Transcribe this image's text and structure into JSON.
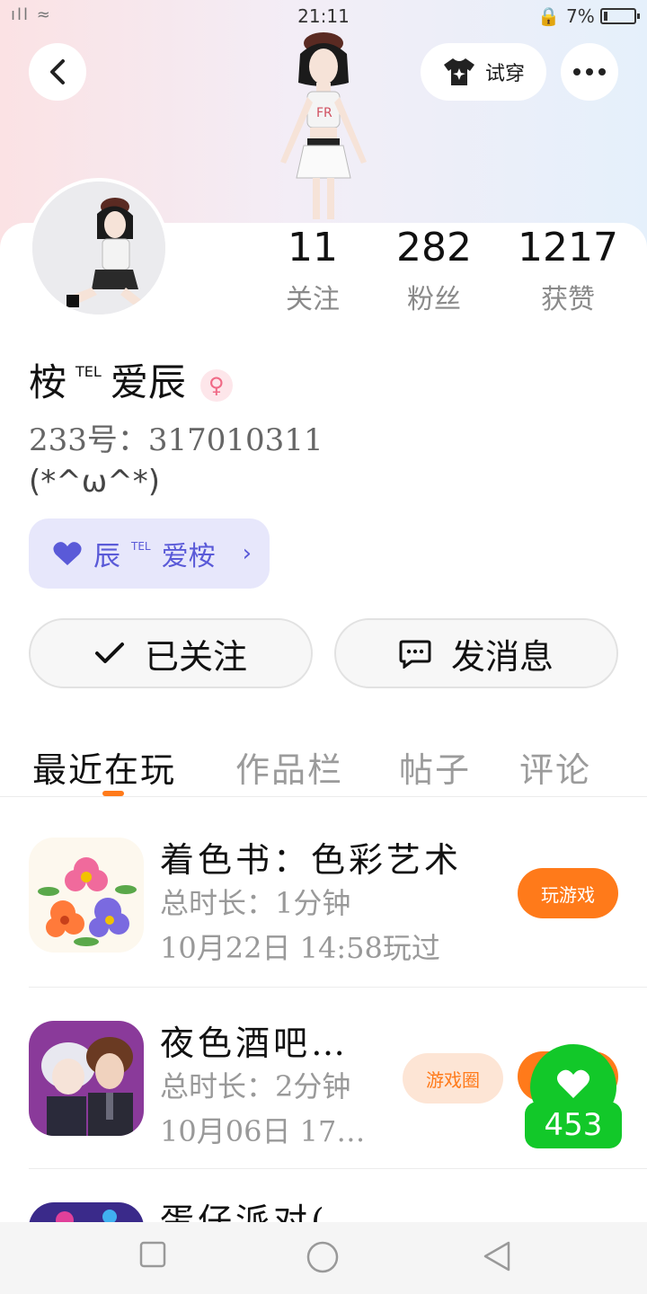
{
  "status_bar": {
    "time": "21:11",
    "battery": "7%"
  },
  "header": {
    "try_on_label": "试穿"
  },
  "stats": [
    {
      "value": "11",
      "label": "关注"
    },
    {
      "value": "282",
      "label": "粉丝"
    },
    {
      "value": "1217",
      "label": "获赞"
    }
  ],
  "profile": {
    "name_part1": "桉",
    "name_tag": "TEL",
    "name_part2": "爱辰",
    "uid": "233号：317010311",
    "signature": "(*^ω^*)",
    "couple_part1": "辰",
    "couple_tag": "TEL",
    "couple_part2": "爱桉"
  },
  "actions": {
    "follow_label": "已关注",
    "message_label": "发消息"
  },
  "tabs": [
    "最近在玩",
    "作品栏",
    "帖子",
    "评论"
  ],
  "games": [
    {
      "name": "着色书：色彩艺术",
      "duration": "总时长：1分钟",
      "last_played": "10月22日 14:58玩过",
      "button": "玩游戏"
    },
    {
      "name": "夜色酒吧…",
      "duration": "总时长：2分钟",
      "last_played": "10月06日 17…",
      "button": "游戏圈"
    },
    {
      "name": "蛋仔派对(…"
    }
  ],
  "floating_like": {
    "count": "453"
  }
}
